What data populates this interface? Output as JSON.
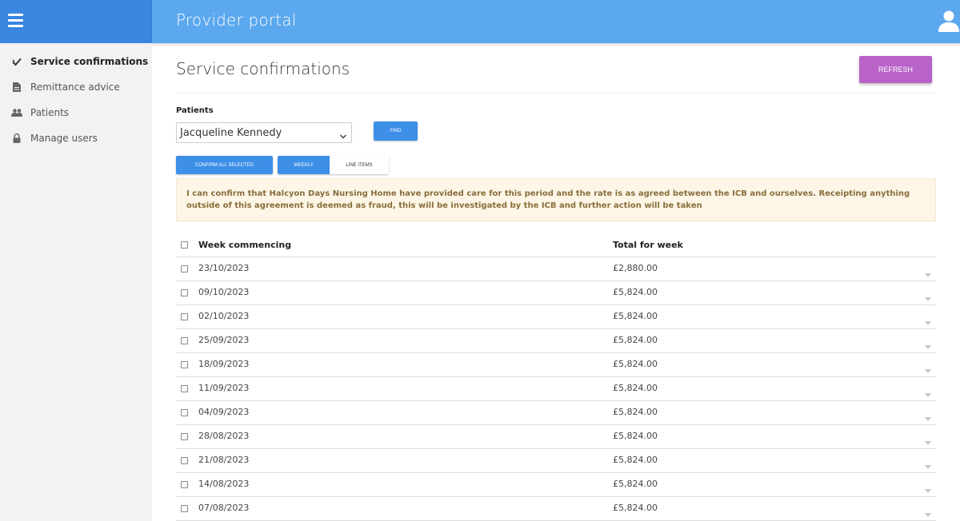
{
  "header": {
    "title": "Provider portal",
    "menu_icon": "hamburger-icon",
    "user_icon": "user-icon"
  },
  "sidebar": {
    "items": [
      {
        "label": "Service confirmations",
        "icon": "check-icon",
        "active": true
      },
      {
        "label": "Remittance advice",
        "icon": "document-icon",
        "active": false
      },
      {
        "label": "Patients",
        "icon": "people-icon",
        "active": false
      },
      {
        "label": "Manage users",
        "icon": "lock-icon",
        "active": false
      }
    ]
  },
  "main": {
    "page_title": "Service confirmations",
    "refresh_label": "REFRESH",
    "patients_label": "Patients",
    "selected_patient": "Jacqueline Kennedy",
    "find_label": "FIND",
    "confirm_all_label": "CONFIRM ALL SELECTED",
    "view_toggle": {
      "weekly": "WEEKLY",
      "line_items": "LINE ITEMS",
      "active": "weekly"
    },
    "notice": "I can confirm that Halcyon Days Nursing Home have provided care for this period and the rate is as agreed between the ICB and ourselves. Receipting anything outside of this agreement is deemed as fraud, this will be investigated by the ICB and further action will be taken"
  },
  "table": {
    "columns": [
      "Week commencing",
      "Total for week"
    ],
    "rows": [
      {
        "week": "23/10/2023",
        "total": "£2,880.00"
      },
      {
        "week": "09/10/2023",
        "total": "£5,824.00"
      },
      {
        "week": "02/10/2023",
        "total": "£5,824.00"
      },
      {
        "week": "25/09/2023",
        "total": "£5,824.00"
      },
      {
        "week": "18/09/2023",
        "total": "£5,824.00"
      },
      {
        "week": "11/09/2023",
        "total": "£5,824.00"
      },
      {
        "week": "04/09/2023",
        "total": "£5,824.00"
      },
      {
        "week": "28/08/2023",
        "total": "£5,824.00"
      },
      {
        "week": "21/08/2023",
        "total": "£5,824.00"
      },
      {
        "week": "14/08/2023",
        "total": "£5,824.00"
      },
      {
        "week": "07/08/2023",
        "total": "£5,824.00"
      }
    ]
  },
  "colors": {
    "brand": "#3a86e0",
    "header": "#5ba8ee",
    "primary_button": "#3d8fe8",
    "refresh_button": "#b963c9",
    "notice_bg": "#fdf6e6",
    "notice_text": "#8a6d3b"
  }
}
